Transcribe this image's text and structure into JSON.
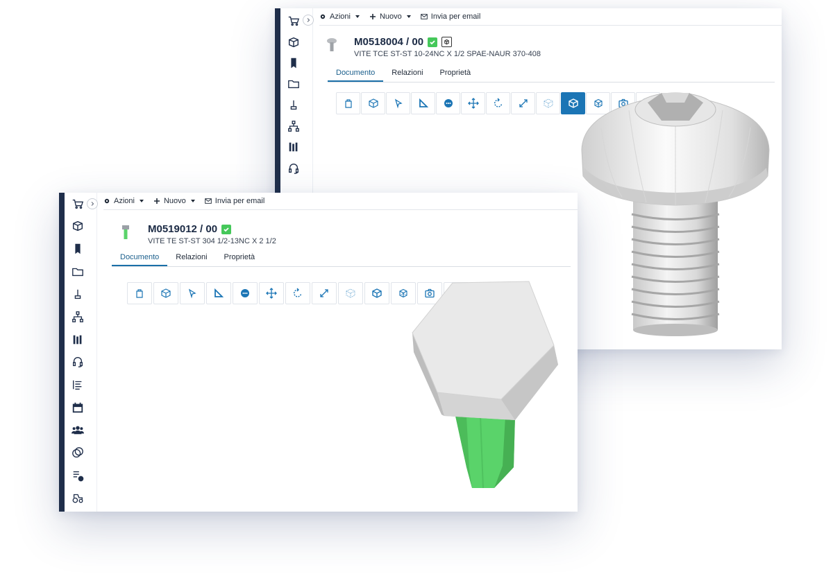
{
  "toolbar": {
    "actions_label": "Azioni",
    "new_label": "Nuovo",
    "email_label": "Invia per email"
  },
  "tabs": [
    {
      "label": "Documento",
      "active": true
    },
    {
      "label": "Relazioni",
      "active": false
    },
    {
      "label": "Proprietà",
      "active": false
    }
  ],
  "back_window": {
    "code": "M0518004 / 00",
    "description": "VITE TCE ST-ST 10-24NC X 1/2 SPAE-NAUR 370-408",
    "status": "approved-check-icon",
    "badge": "cube-badge-icon",
    "model": "button-head-socket-screw"
  },
  "front_window": {
    "code": "M0519012 / 00",
    "description": "VITE TE ST-ST 304 1/2-13NC X 2 1/2",
    "status": "approved-check-icon",
    "model": "hex-head-bolt"
  },
  "sidebar_icons_back": [
    "cart-icon",
    "box-icon",
    "bookmark-icon",
    "folder-icon",
    "pin-icon",
    "hierarchy-icon",
    "library-icon",
    "headset-icon"
  ],
  "sidebar_icons_front": [
    "cart-icon",
    "box-icon",
    "bookmark-icon",
    "folder-icon",
    "pin-icon",
    "hierarchy-icon",
    "library-icon",
    "headset-icon",
    "list-icon",
    "calendar-icon",
    "users-icon",
    "coins-icon",
    "report-clock-icon",
    "tractor-icon"
  ],
  "viewer_tools": [
    "bag-icon",
    "cube-outline-icon",
    "select-arrow-icon",
    "measure-icon",
    "comment-icon",
    "move-icon",
    "rotate-icon",
    "resize-icon",
    "cube-transparent-icon",
    "cube-solid-icon",
    "cube-wire-icon",
    "camera-icon",
    "fullscreen-icon"
  ],
  "viewer_active_tool_back": "cube-solid-icon",
  "colors": {
    "rail": "#1f2e4a",
    "accent": "#1b75b5",
    "check": "#45c85a",
    "bolt_shank": "#5ad36a",
    "metal": "#dcdcdc"
  }
}
